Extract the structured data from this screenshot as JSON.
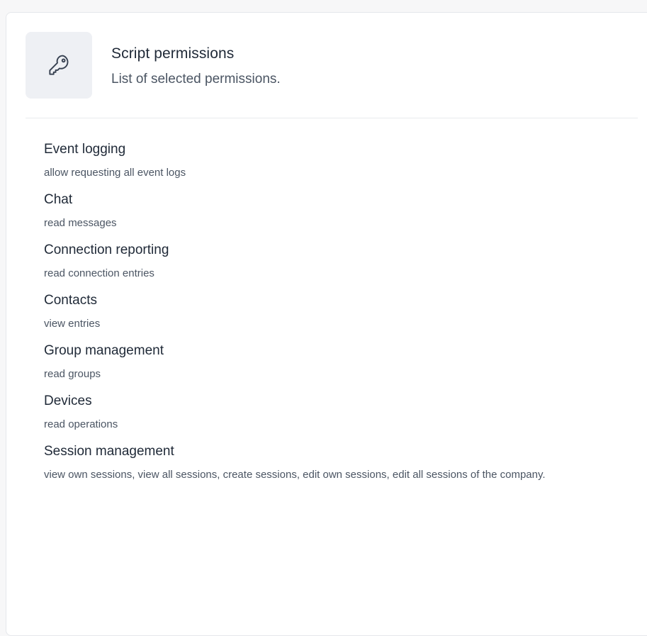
{
  "header": {
    "icon": "key-icon",
    "title": "Script permissions",
    "subtitle": "List of selected permissions."
  },
  "permissions": [
    {
      "name": "Event logging",
      "description": "allow requesting all event logs"
    },
    {
      "name": "Chat",
      "description": "read messages"
    },
    {
      "name": "Connection reporting",
      "description": "read connection entries"
    },
    {
      "name": "Contacts",
      "description": "view entries"
    },
    {
      "name": "Group management",
      "description": "read groups"
    },
    {
      "name": "Devices",
      "description": "read operations"
    },
    {
      "name": "Session management",
      "description": "view own sessions, view all sessions, create sessions, edit own sessions, edit all sessions of the company."
    }
  ],
  "colors": {
    "text_primary": "#1f2937",
    "text_secondary": "#4b5563",
    "icon_tile_bg": "#eef0f4",
    "divider": "#e8eaee"
  }
}
